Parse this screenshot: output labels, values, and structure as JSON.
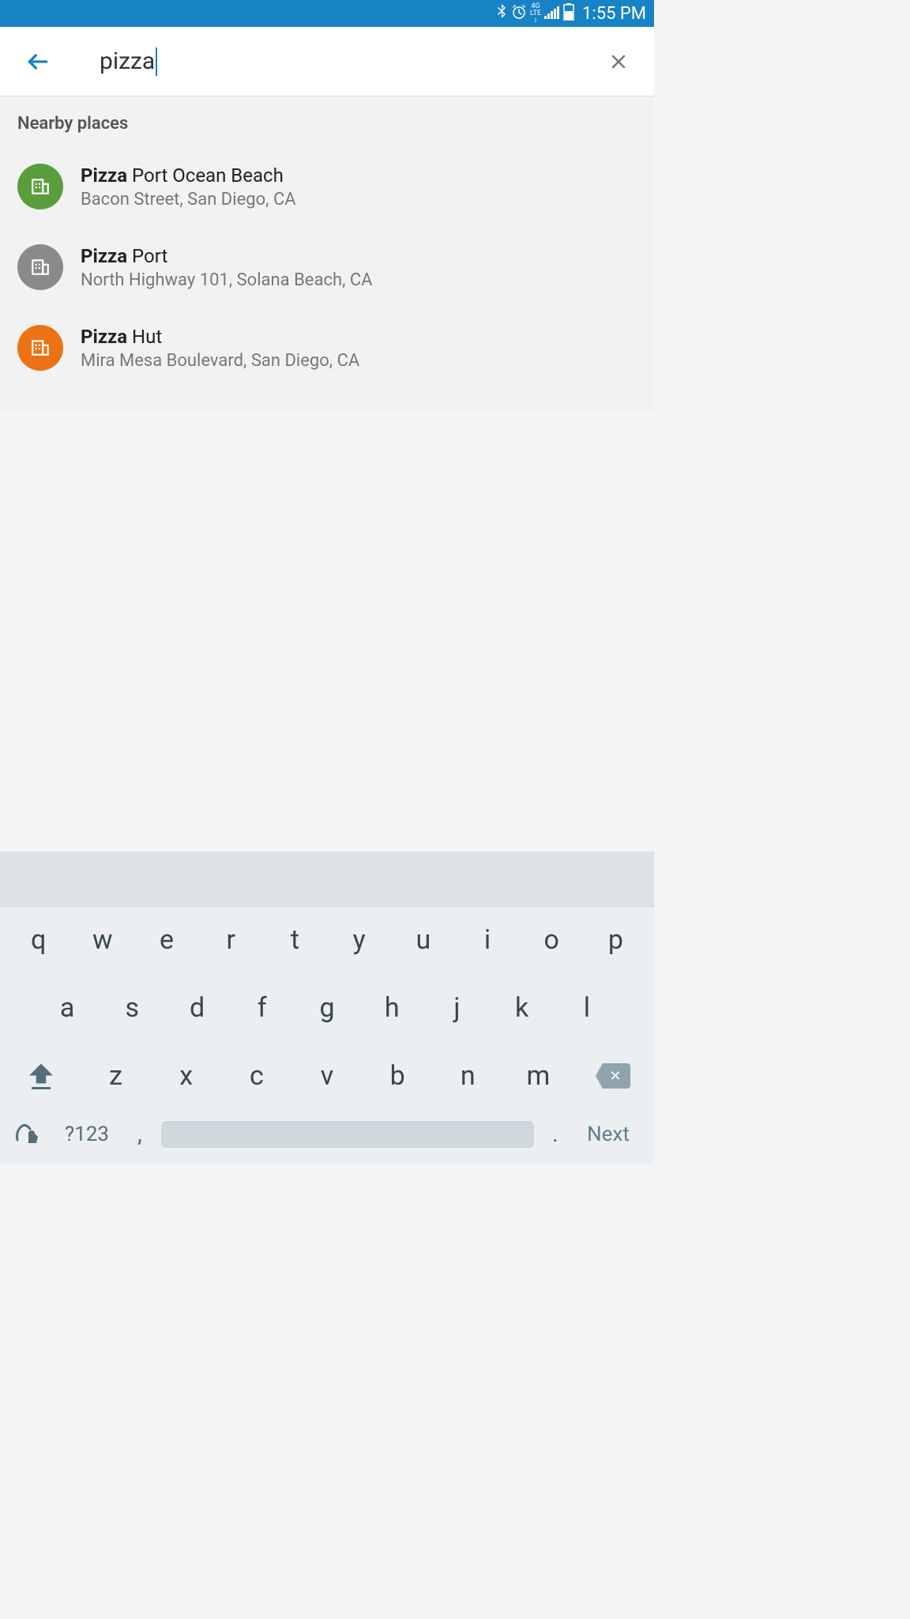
{
  "statusBar": {
    "time": "1:55 PM",
    "network": "4G LTE"
  },
  "search": {
    "query": "pizza"
  },
  "sectionTitle": "Nearby places",
  "places": [
    {
      "match": "Pizza",
      "rest": " Port Ocean Beach",
      "address": "Bacon Street, San Diego, CA",
      "iconColor": "green"
    },
    {
      "match": "Pizza",
      "rest": " Port",
      "address": "North Highway 101, Solana Beach, CA",
      "iconColor": "gray"
    },
    {
      "match": "Pizza",
      "rest": " Hut",
      "address": "Mira Mesa Boulevard, San Diego, CA",
      "iconColor": "orange"
    }
  ],
  "keyboard": {
    "row1": [
      "q",
      "w",
      "e",
      "r",
      "t",
      "y",
      "u",
      "i",
      "o",
      "p"
    ],
    "row2": [
      "a",
      "s",
      "d",
      "f",
      "g",
      "h",
      "j",
      "k",
      "l"
    ],
    "row3": [
      "z",
      "x",
      "c",
      "v",
      "b",
      "n",
      "m"
    ],
    "numKey": "?123",
    "comma": ",",
    "period": ".",
    "next": "Next"
  }
}
